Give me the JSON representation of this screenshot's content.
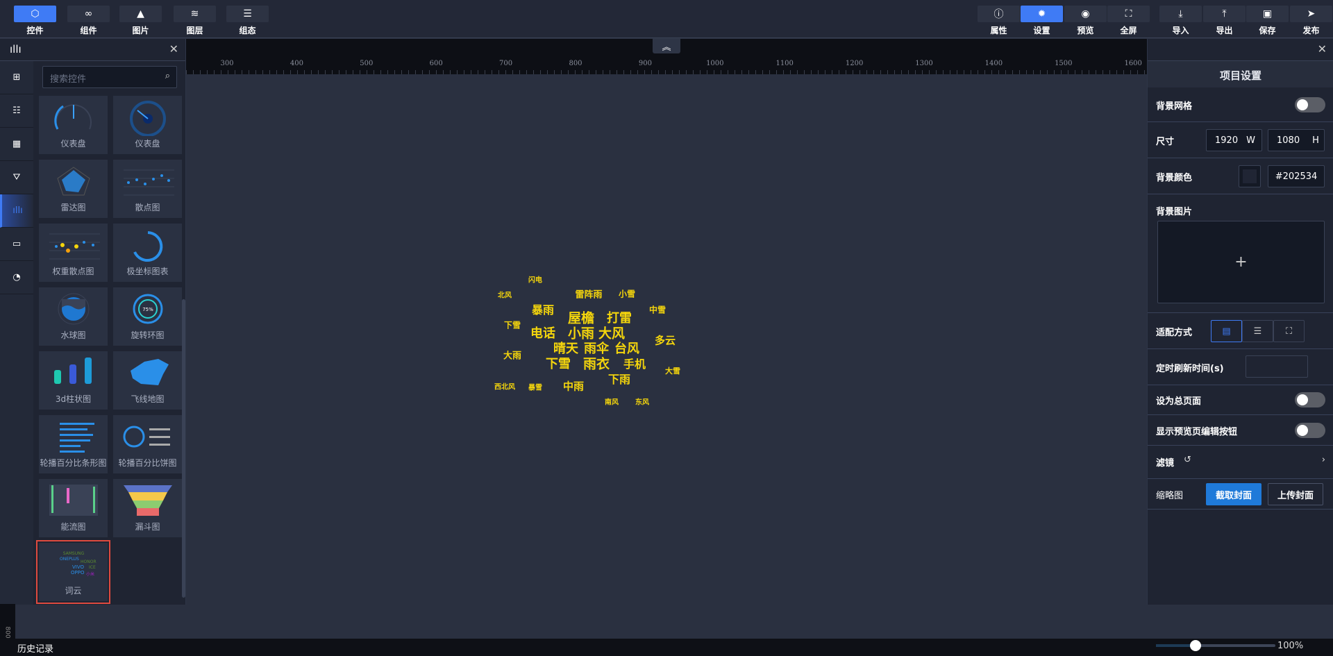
{
  "toolbar": {
    "left": [
      {
        "label": "控件",
        "icon": "cube-icon",
        "active": true
      },
      {
        "label": "组件",
        "icon": "link-icon"
      },
      {
        "label": "图片",
        "icon": "image-icon"
      },
      {
        "label": "图层",
        "icon": "layers-icon"
      },
      {
        "label": "组态",
        "icon": "align-icon"
      }
    ],
    "right": [
      {
        "label": "属性",
        "icon": "info-icon"
      },
      {
        "label": "设置",
        "icon": "gear-icon",
        "active": true
      },
      {
        "label": "预览",
        "icon": "eye-icon"
      },
      {
        "label": "全屏",
        "icon": "fullscreen-icon"
      },
      {
        "label": "导入",
        "icon": "import-icon"
      },
      {
        "label": "导出",
        "icon": "export-icon"
      },
      {
        "label": "保存",
        "icon": "save-icon"
      },
      {
        "label": "发布",
        "icon": "send-icon"
      }
    ]
  },
  "left_panel": {
    "search_placeholder": "搜索控件",
    "categories": [
      "grid-icon",
      "sliders-icon",
      "table-icon",
      "filter-icon",
      "bar-chart-icon",
      "video-icon",
      "pie-chart-icon"
    ],
    "active_category": 4,
    "components": [
      {
        "label": "仪表盘"
      },
      {
        "label": "仪表盘"
      },
      {
        "label": "雷达图"
      },
      {
        "label": "散点图"
      },
      {
        "label": "权重散点图"
      },
      {
        "label": "极坐标图表"
      },
      {
        "label": "水球图"
      },
      {
        "label": "旋转环图"
      },
      {
        "label": "3d柱状图"
      },
      {
        "label": "飞线地图"
      },
      {
        "label": "轮播百分比条形图"
      },
      {
        "label": "轮播百分比饼图"
      },
      {
        "label": "能流图"
      },
      {
        "label": "漏斗图"
      },
      {
        "label": "词云",
        "selected": true
      }
    ]
  },
  "ruler": {
    "labels": [
      "300",
      "400",
      "500",
      "600",
      "700",
      "800",
      "900",
      "1000",
      "1100",
      "1200",
      "1300",
      "1400",
      "1500",
      "1600"
    ],
    "vertical_label": "800"
  },
  "canvas": {
    "word_cloud": [
      "闪电",
      "北风",
      "雷阵雨",
      "小雪",
      "暴雨",
      "中雪",
      "屋檐",
      "打雷",
      "下雪",
      "电话",
      "小雨",
      "大风",
      "多云",
      "晴天",
      "雨伞",
      "台风",
      "大雨",
      "下雪",
      "雨衣",
      "手机",
      "大雪",
      "下雨",
      "西北风",
      "暴雪",
      "中雨",
      "南风",
      "东风"
    ],
    "word_color": "#f4d50c"
  },
  "right_panel": {
    "title": "项目设置",
    "bg_grid_label": "背景网格",
    "bg_grid_on": false,
    "size_label": "尺寸",
    "width": "1920",
    "width_unit": "W",
    "height": "1080",
    "height_unit": "H",
    "bg_color_label": "背景颜色",
    "bg_color": "#202534",
    "bg_image_label": "背景图片",
    "upload_plus": "+",
    "fit_label": "适配方式",
    "refresh_label": "定时刷新时间(s)",
    "refresh_value": "",
    "home_label": "设为总页面",
    "home_on": false,
    "edit_btn_label": "显示预览页编辑按钮",
    "edit_btn_on": false,
    "filter_label": "滤镜",
    "thumb_label": "缩略图",
    "capture_btn": "截取封面",
    "upload_btn": "上传封面"
  },
  "bottom": {
    "history_label": "历史记录",
    "zoom": "100%",
    "zoom_fraction": 0.33
  }
}
